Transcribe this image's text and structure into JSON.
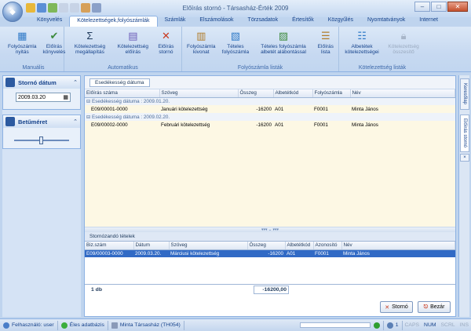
{
  "window": {
    "title": "Előírás stornó - Társasház-Érték 2009"
  },
  "tabs": [
    "Könyvelés",
    "Kötelezettségek,folyószámlák",
    "Számlák",
    "Elszámolások",
    "Törzsadatok",
    "Értesítők",
    "Közgyűlés",
    "Nyomtatványok",
    "Internet"
  ],
  "ribbon": {
    "groups": [
      {
        "label": "Manuális",
        "buttons": [
          "Folyószámla nyitás",
          "Előírás könyvelés"
        ]
      },
      {
        "label": "Automatikus",
        "buttons": [
          "Kötelezettség megállapítás",
          "Kötelezettség előírás",
          "Előírás stornó"
        ]
      },
      {
        "label": "Folyószámla listák",
        "buttons": [
          "Folyószámla kivonat",
          "Tételes folyószámla",
          "Tételes folyószámla albetét alábontással",
          "Előírás lista"
        ]
      },
      {
        "label": "Kötelezettség listák",
        "buttons": [
          "Albetétek kötelezettségei",
          "Kötelezettség összesítő"
        ]
      }
    ]
  },
  "left": {
    "storno_title": "Stornó dátum",
    "storno_date": "2009.03.20",
    "font_title": "Betűméret",
    "font_level": 0.45
  },
  "grid": {
    "group_chip": "Esedékesség dátuma",
    "columns": [
      "Előírás száma",
      "Szöveg",
      "Összeg",
      "Albetétkód",
      "Folyószámla",
      "Név"
    ],
    "groups": [
      {
        "label": "Esedékesség dátuma : 2009.01.20.",
        "rows": [
          {
            "szam": "E09/00001-0000",
            "szoveg": "Januári kötelezettség",
            "osszeg": "-16200",
            "albetet": "A01",
            "folyo": "F0001",
            "nev": "Minta János"
          }
        ]
      },
      {
        "label": "Esedékesség dátuma : 2009.02.20.",
        "rows": [
          {
            "szam": "E09/00002-0000",
            "szoveg": "Februári kötelezettség",
            "osszeg": "-16200",
            "albetet": "A01",
            "folyo": "F0001",
            "nev": "Minta János"
          }
        ]
      }
    ]
  },
  "lower": {
    "title": "Stornózandó tételek",
    "columns": [
      "Biz.szám",
      "Dátum",
      "Szöveg",
      "Összeg",
      "Albetétkód",
      "Azonosító",
      "Név"
    ],
    "row": {
      "szam": "E09/00003-0000",
      "datum": "2009.03.20.",
      "szoveg": "Márciusi kötelezettség",
      "osszeg": "-16200",
      "albetet": "A01",
      "azon": "F0001",
      "nev": "Minta János"
    },
    "count": "1 db",
    "sum": "-16200,00"
  },
  "buttons": {
    "storno": "Stornó",
    "bezar": "Bezár"
  },
  "sidebar": {
    "tab1": "Keresőlap",
    "tab2": "Előírás stornó"
  },
  "status": {
    "user": "Felhasználó: user",
    "db": "Éles adatbázis",
    "house": "Minta Társasház (TH054)",
    "num": "1",
    "caps": "CAPS",
    "numlock": "NUM",
    "scrl": "SCRL",
    "ins": "INS"
  }
}
